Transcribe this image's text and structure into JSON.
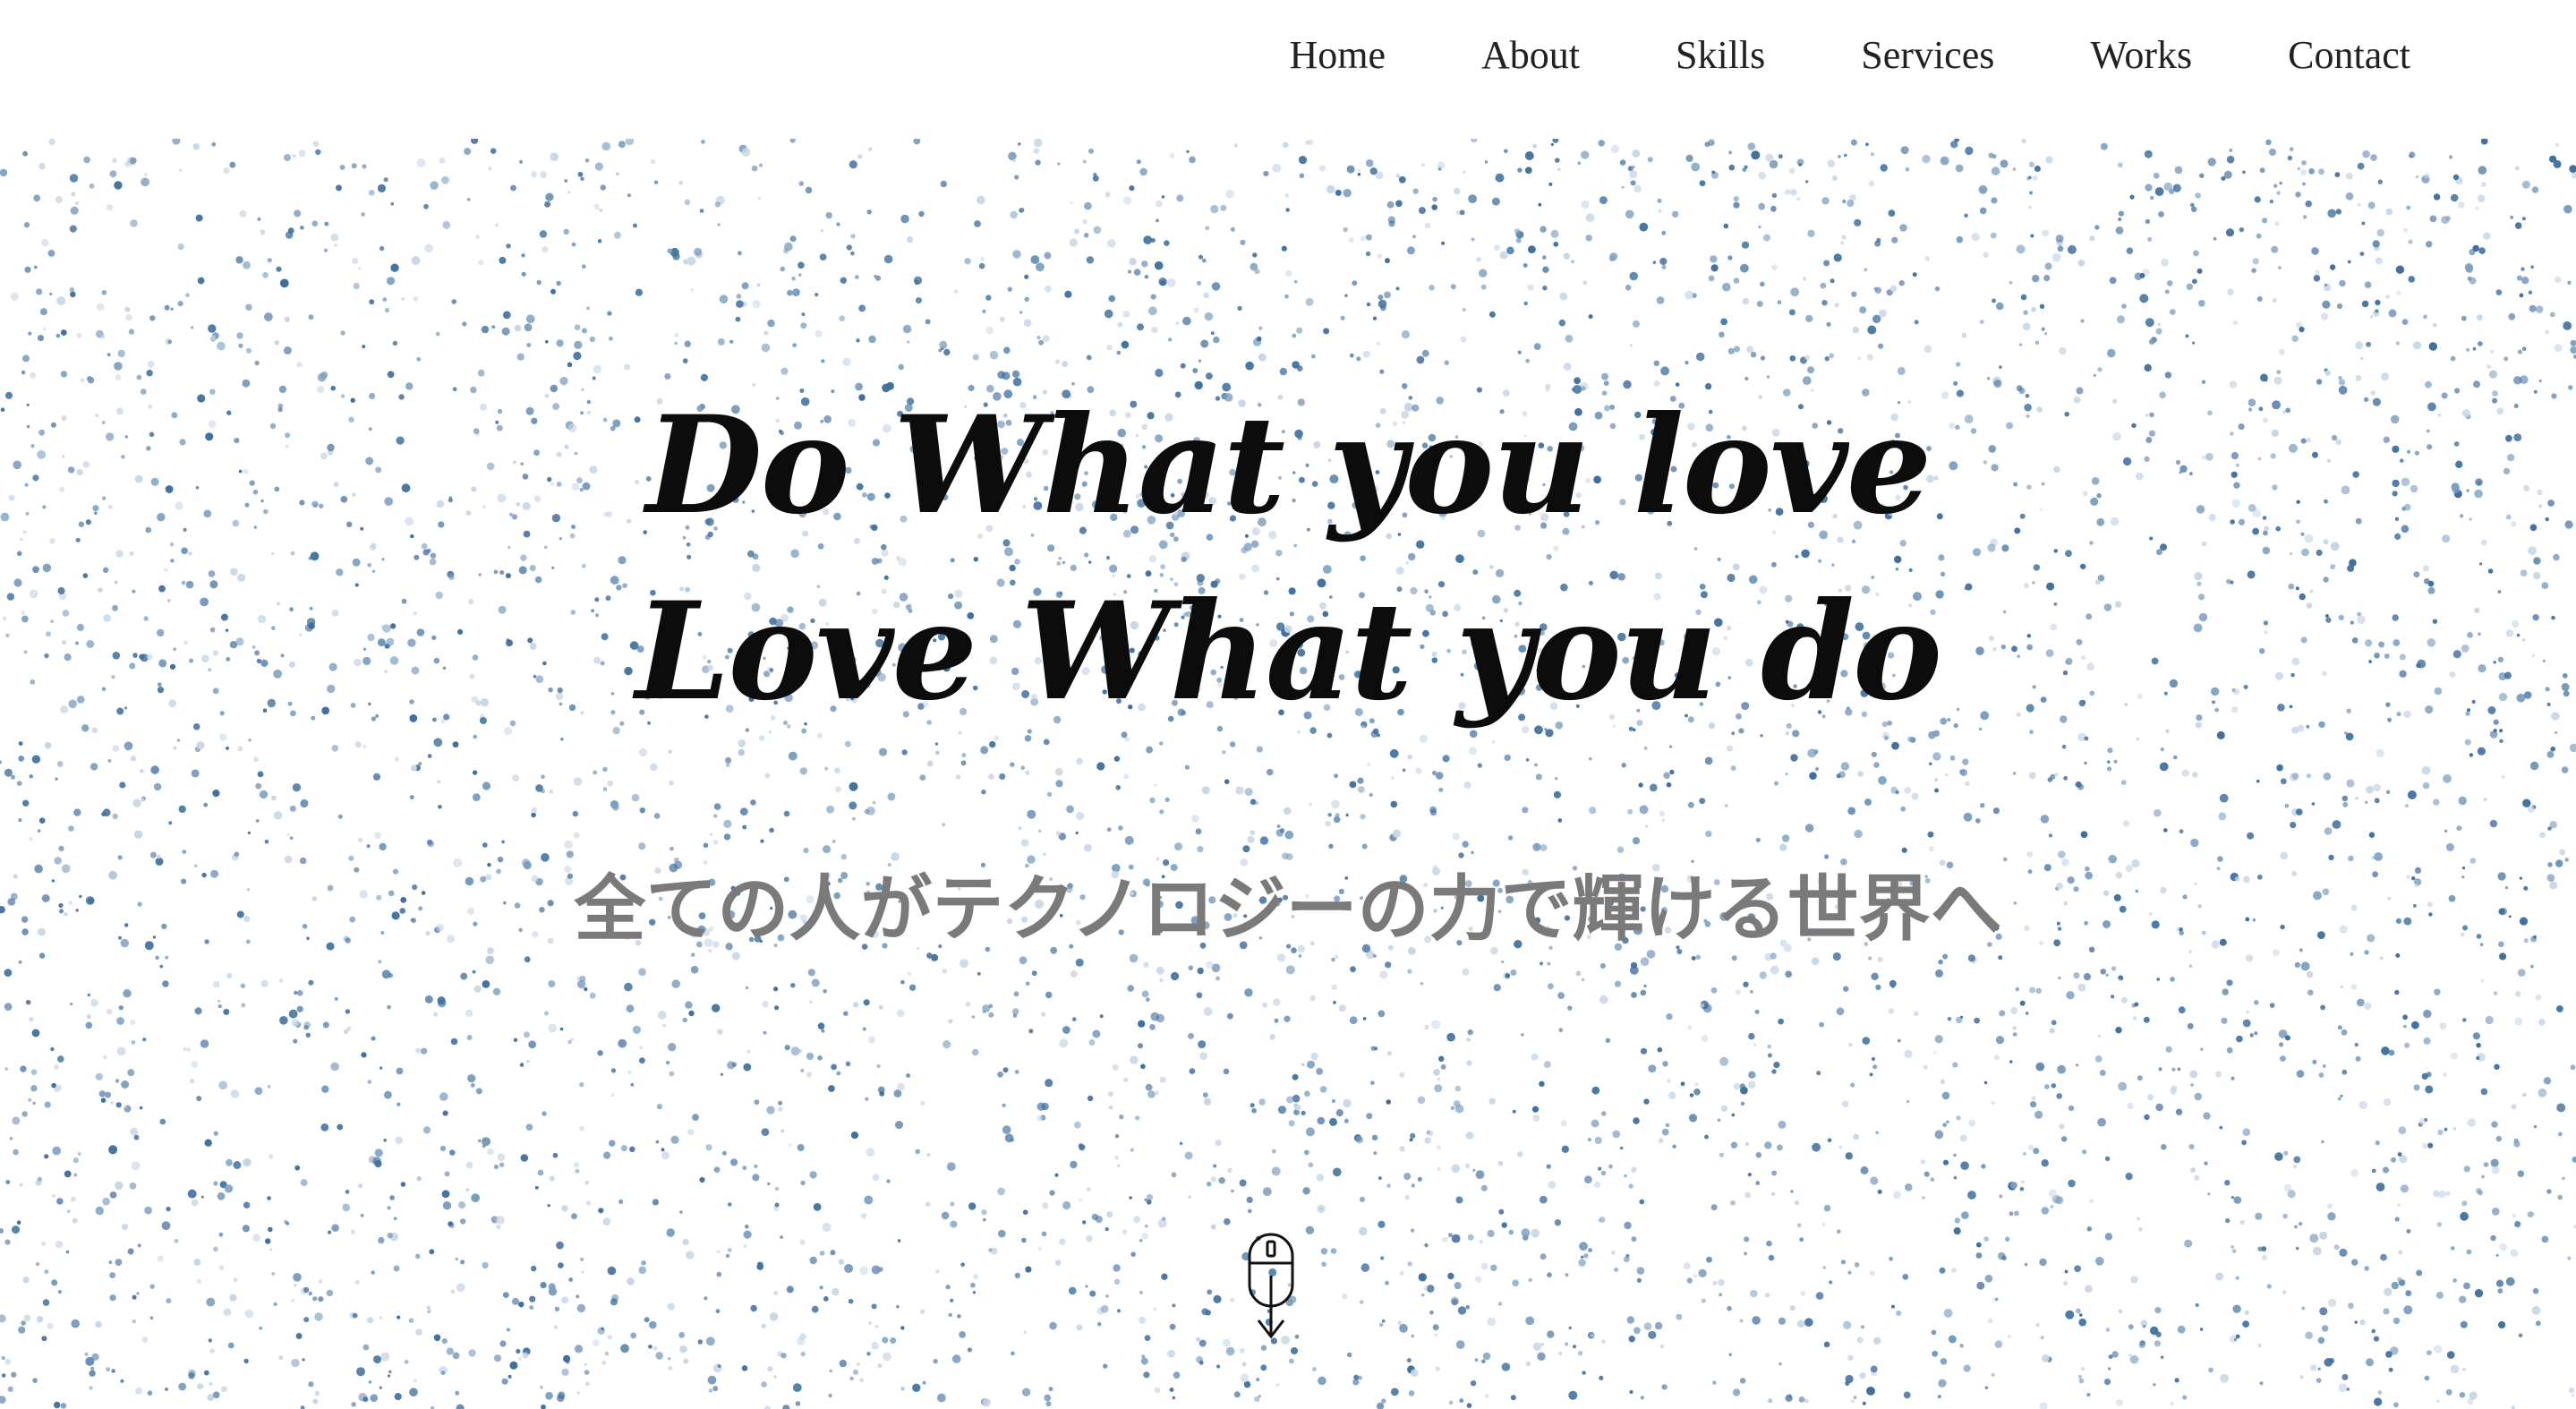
{
  "nav": {
    "items": [
      {
        "label": "Home"
      },
      {
        "label": "About"
      },
      {
        "label": "Skills"
      },
      {
        "label": "Services"
      },
      {
        "label": "Works"
      },
      {
        "label": "Contact"
      }
    ]
  },
  "hero": {
    "headline_line1": "Do What you love",
    "headline_line2": "Love What you do",
    "subtitle": "全ての人がテクノロジーの力で輝ける世界へ",
    "scroll_icon": "mouse-scroll-down-icon"
  },
  "colors": {
    "particle_dark": "#3f6f9e",
    "particle_mid": "#7a9dbf",
    "particle_light": "#c8d6e5",
    "headline": "#0c0c0c",
    "subtitle": "#7a7a7a"
  }
}
